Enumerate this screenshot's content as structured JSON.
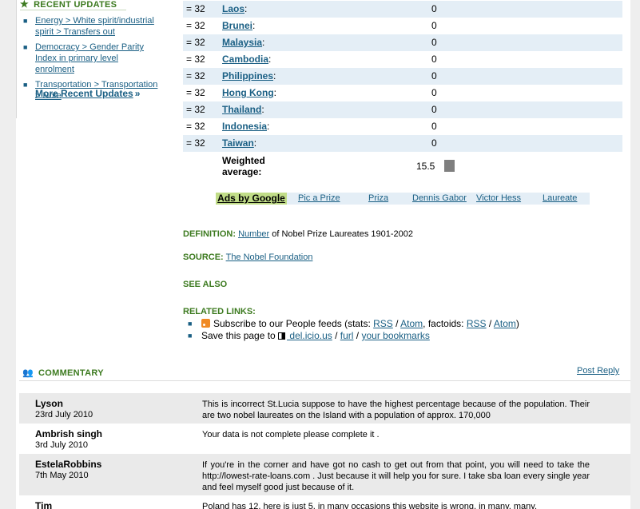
{
  "sidebar": {
    "heading": "RECENT UPDATES",
    "items": [
      {
        "label": "Energy > White spirit/industrial spirit > Transfers out"
      },
      {
        "label": "Democracy > Gender Parity Index in primary level enrolment"
      },
      {
        "label": "Transportation > Transportation > Note"
      }
    ],
    "more_label": "More Recent Updates",
    "more_suffix": "»"
  },
  "ranking": {
    "rows": [
      {
        "rank": "= 32",
        "country": "Laos",
        "value": "0"
      },
      {
        "rank": "= 32",
        "country": "Brunei",
        "value": "0"
      },
      {
        "rank": "= 32",
        "country": "Malaysia",
        "value": "0"
      },
      {
        "rank": "= 32",
        "country": "Cambodia",
        "value": "0"
      },
      {
        "rank": "= 32",
        "country": "Philippines",
        "value": "0"
      },
      {
        "rank": "= 32",
        "country": "Hong Kong",
        "value": "0"
      },
      {
        "rank": "= 32",
        "country": "Thailand",
        "value": "0"
      },
      {
        "rank": "= 32",
        "country": "Indonesia",
        "value": "0"
      },
      {
        "rank": "= 32",
        "country": "Taiwan",
        "value": "0"
      }
    ],
    "weighted_label_line1": "Weighted",
    "weighted_label_line2": "average:",
    "weighted_value": "15.5"
  },
  "ads": {
    "label": "Ads by Google",
    "links": [
      "Pic a Prize",
      "Priza",
      "Dennis Gabor",
      "Victor Hess",
      "Laureate"
    ]
  },
  "definition": {
    "heading": "DEFINITION:",
    "link": "Number",
    "text": " of Nobel Prize Laureates 1901-2002"
  },
  "source": {
    "heading": "SOURCE:",
    "link": "The Nobel Foundation"
  },
  "see_also": {
    "heading": "SEE ALSO"
  },
  "related": {
    "heading": "RELATED LINKS:",
    "subscribe_text": "Subscribe to our People feeds (stats: ",
    "rss": "RSS",
    "sep": " / ",
    "atom": "Atom",
    "factoids_text": ", factoids: ",
    "close": ")",
    "save_text": "Save this page to ",
    "delicious": " del.icio.us",
    "furl": "furl",
    "bookmarks": "your bookmarks"
  },
  "commentary": {
    "heading": "COMMENTARY",
    "post_reply": "Post Reply",
    "comments": [
      {
        "name": "Lyson",
        "date": "23rd July 2010",
        "text": "This is incorrect St.Lucia suppose to have the highest percentage because of the population. Their are two nobel laureates on the Island with a population of approx. 170,000"
      },
      {
        "name": "Ambrish singh",
        "date": "3rd July 2010",
        "text": "Your data is not complete please complete it ."
      },
      {
        "name": "EstelaRobbins",
        "date": "7th May 2010",
        "text": "If you're in the corner and have got no cash to get out from that point, you will need to take the http://lowest-rate-loans.com . Just because it will help you for sure. I take sba loan every single year and feel myself good just because of it."
      },
      {
        "name": "Tim",
        "date": "",
        "text": "Poland has 12, here is just 5, in many occasions this website is wrong, in many, many."
      }
    ]
  },
  "colors": {
    "heading_green": "#3c7a1f",
    "link_blue": "#1a5f84",
    "row_shade": "#e4eef6",
    "ads_label_bg": "#c1dd88",
    "bar_gray": "#7f7f7f"
  }
}
